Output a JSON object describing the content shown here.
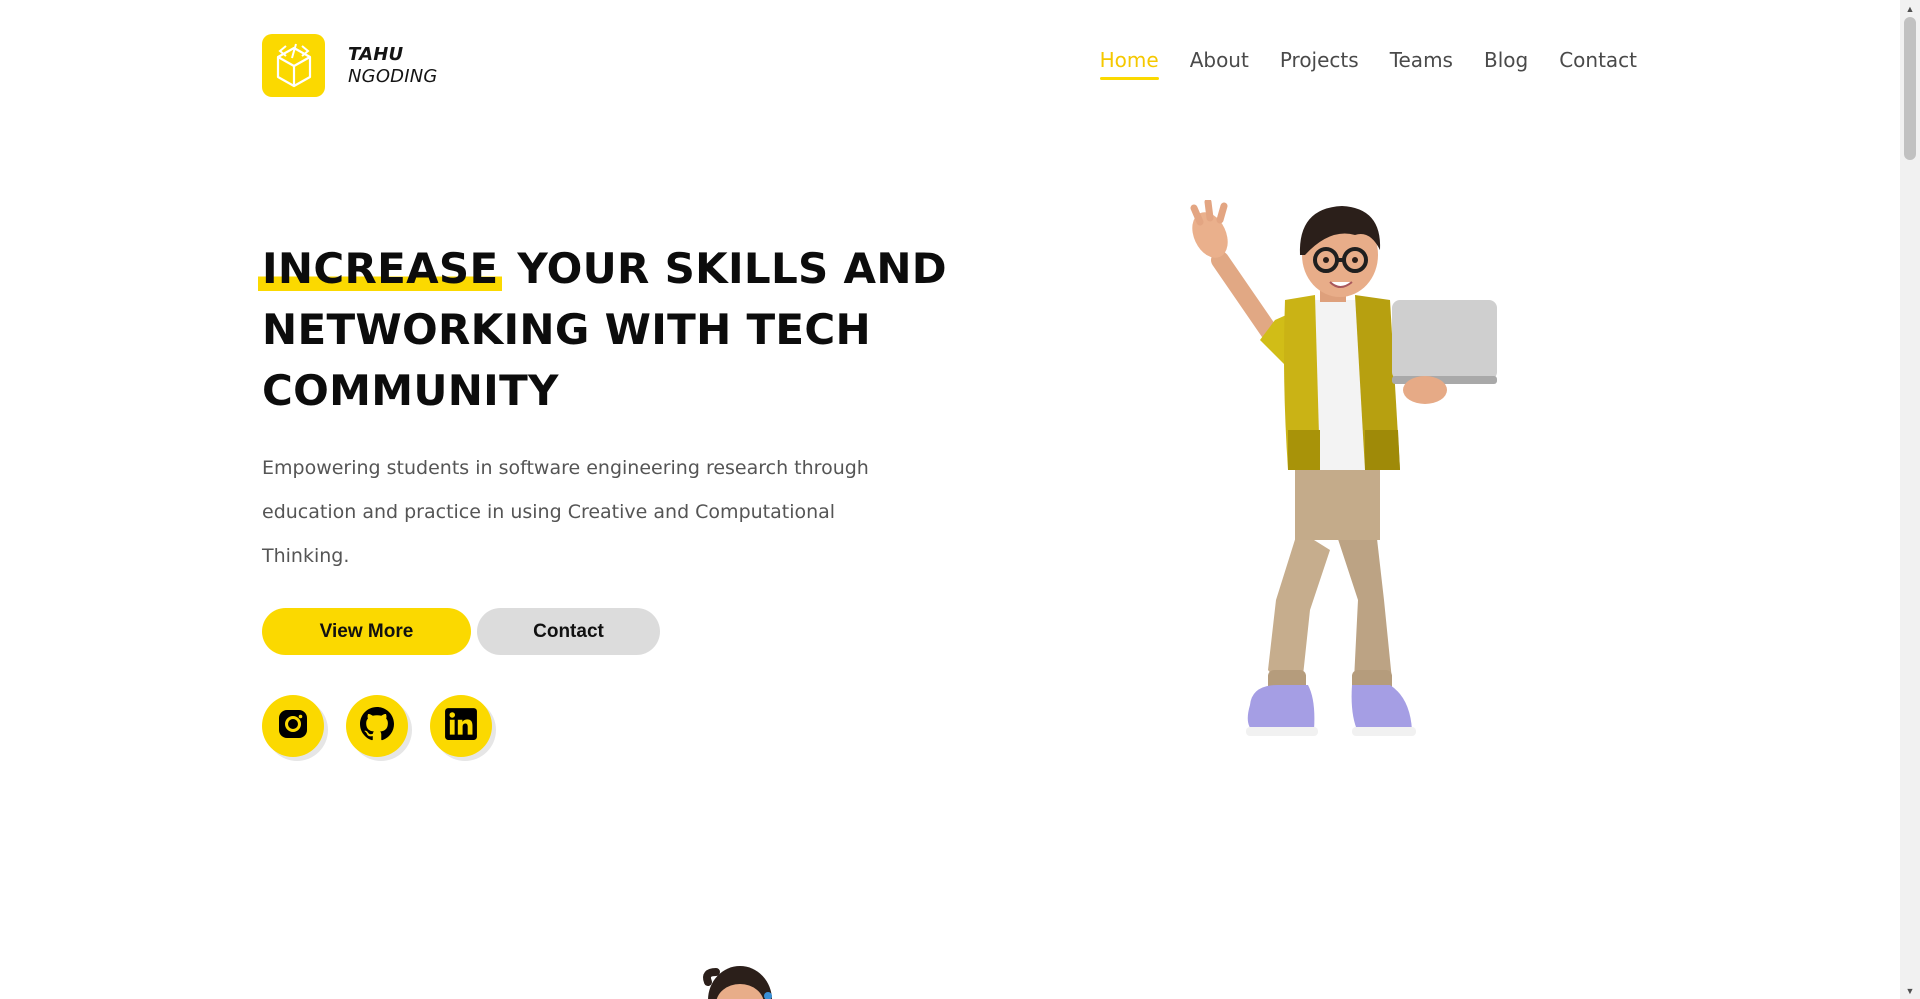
{
  "brand": {
    "line1": "TAHU",
    "line2": "NGODING",
    "logo_icon": "code-cube-icon"
  },
  "nav": {
    "items": [
      {
        "label": "Home",
        "active": true
      },
      {
        "label": "About",
        "active": false
      },
      {
        "label": "Projects",
        "active": false
      },
      {
        "label": "Teams",
        "active": false
      },
      {
        "label": "Blog",
        "active": false
      },
      {
        "label": "Contact",
        "active": false
      }
    ]
  },
  "hero": {
    "headline_highlight": "INCREASE",
    "headline_rest": " YOUR SKILLS AND NETWORKING WITH TECH COMMUNITY",
    "subtitle": "Empowering students in software engineering research through education and practice in using Creative and Computational Thinking.",
    "primary_button": "View More",
    "secondary_button": "Contact"
  },
  "social": [
    {
      "icon": "instagram-icon"
    },
    {
      "icon": "github-icon"
    },
    {
      "icon": "linkedin-icon"
    }
  ],
  "colors": {
    "accent": "#fbd900",
    "nav_active": "#f5c800",
    "text_dark": "#0c0c0c",
    "text_body": "#555555",
    "button_secondary": "#dcdcdc"
  }
}
